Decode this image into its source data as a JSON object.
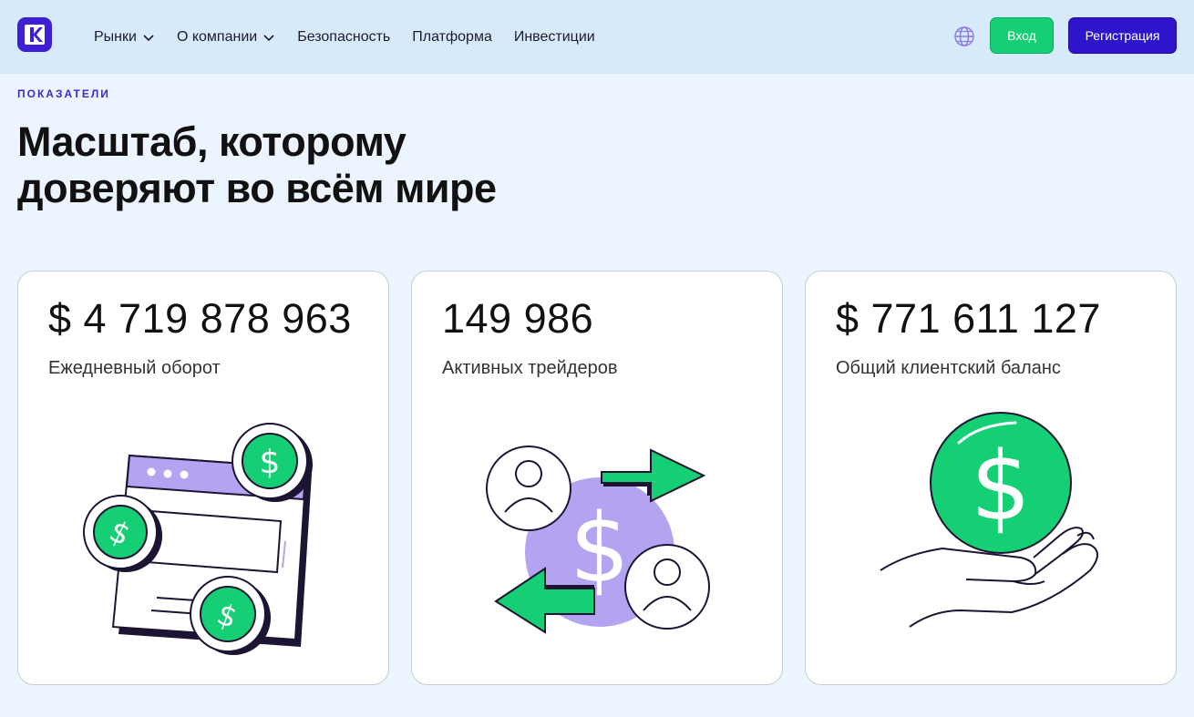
{
  "header": {
    "nav": [
      {
        "label": "Рынки",
        "has_dropdown": true
      },
      {
        "label": "О компании",
        "has_dropdown": true
      },
      {
        "label": "Безопасность",
        "has_dropdown": false
      },
      {
        "label": "Платформа",
        "has_dropdown": false
      },
      {
        "label": "Инвестиции",
        "has_dropdown": false
      }
    ],
    "language_icon": "globe-icon",
    "login_label": "Вход",
    "register_label": "Регистрация"
  },
  "section": {
    "eyebrow": "ПОКАЗАТЕЛИ",
    "title_line1": "Масштаб, которому",
    "title_line2": "доверяют во всём мире"
  },
  "cards": [
    {
      "value": "$ 4 719 878 963",
      "label": "Ежедневный оборот",
      "illustration": "coins-browser-illustration"
    },
    {
      "value": "149 986",
      "label": "Активных трейдеров",
      "illustration": "traders-exchange-illustration"
    },
    {
      "value": "$ 771 611 127",
      "label": "Общий клиентский баланс",
      "illustration": "hand-coin-illustration"
    }
  ],
  "colors": {
    "brand": "#2e15cc",
    "accent_green": "#14cf74",
    "accent_purple": "#b4a3f0",
    "background": "#ecf4ff",
    "header_background": "#d7eafc"
  }
}
